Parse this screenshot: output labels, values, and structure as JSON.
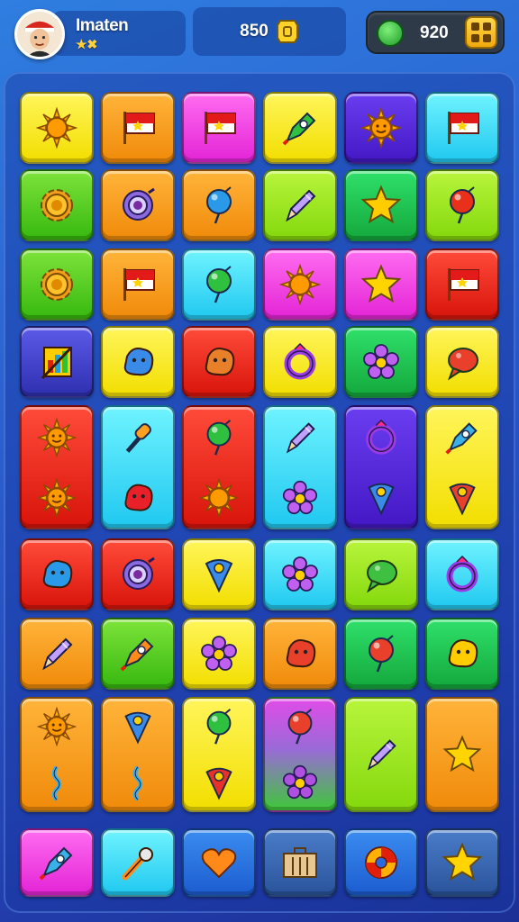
{
  "hud": {
    "player_name": "Imaten",
    "player_sub": "★✖",
    "score": "850",
    "coins": "920",
    "avatar_icon": "player-avatar-icon",
    "score_icon": "coin-icon",
    "coins_icon": "green-gem-icon",
    "menu_icon": "grid-menu-icon"
  },
  "board": {
    "rows": [
      [
        "red-sun-lollipop-icon",
        "red-flag-icon",
        "red-flag-icon",
        "green-rocket-icon",
        "sun-face-icon",
        "red-flag-icon"
      ],
      [
        "sun-gear-icon",
        "target-icon",
        "blue-balloon-icon",
        "pencil-icon",
        "star-wand-icon",
        "red-balloon-icon"
      ],
      [
        "sun-gear-icon",
        "red-flag-icon",
        "green-balloon-icon",
        "sun-icon",
        "star-icon",
        "red-flag-icon"
      ],
      [
        "chart-icon",
        "turtle-icon",
        "dinosaur-icon",
        "ring-icon",
        "flower-icon",
        "fish-icon"
      ],
      [
        "sun-face-icon / sun-face-icon",
        "dropper-icon / bow-icon",
        "balloon-icon / sun-icon",
        "pencil-icon / flower-icon",
        "ring-icon / cone-icon",
        "rocket-icon / eye-icon"
      ],
      [
        "puzzle-icon",
        "planet-icon",
        "cone-icon",
        "flower-icon",
        "speech-bubble-icon",
        "ring-icon"
      ],
      [
        "pencil-icon",
        "carrot-icon",
        "flower-icon",
        "crab-icon",
        "pin-icon",
        "smiley-icon"
      ],
      [
        "lion-icon / squiggle-icon",
        "cone-icon / squiggle-icon",
        "balloon-icon / pepper-icon",
        "pin-icon / gear-icon",
        "pencil-icon",
        "star-icon"
      ]
    ],
    "bottom_bar": [
      "rocket-icon",
      "wrench-icon",
      "heart-icon",
      "box-icon",
      "swirl-icon",
      "star-icon"
    ]
  },
  "colors": {
    "yellow": "#f2de00",
    "orange": "#f08a0a",
    "pink": "#e324d6",
    "purple": "#4318c4",
    "cyan": "#20c8f0",
    "green": "#37b80f",
    "lime": "#84d80c",
    "red": "#d8140a"
  }
}
